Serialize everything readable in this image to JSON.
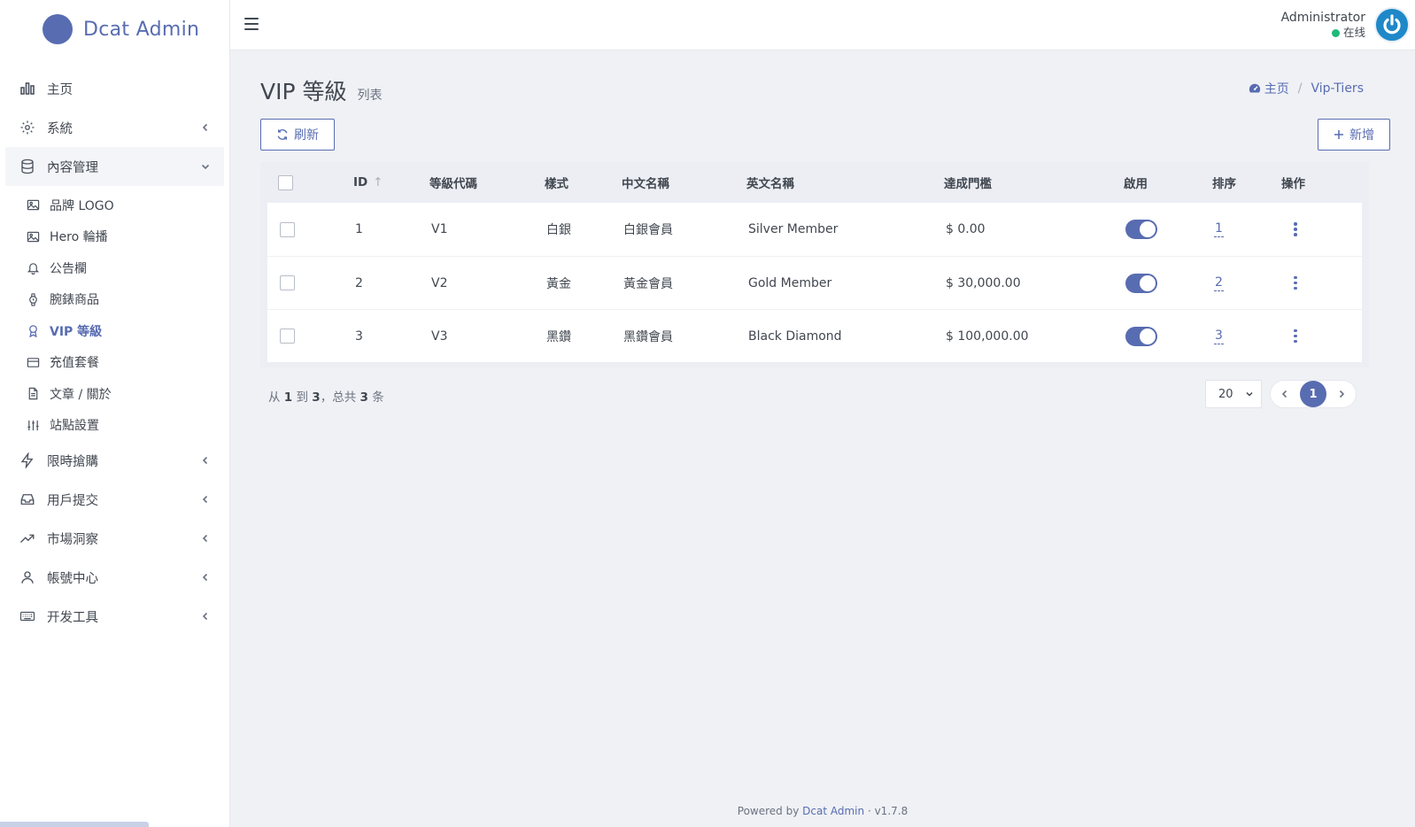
{
  "brand": {
    "name": "Dcat Admin"
  },
  "sidebar": {
    "items": [
      {
        "label": "主页",
        "icon": "bar-chart-icon"
      },
      {
        "label": "系統",
        "icon": "gear-icon"
      },
      {
        "label": "內容管理",
        "icon": "database-icon"
      },
      {
        "label": "限時搶購",
        "icon": "lightning-icon"
      },
      {
        "label": "用戶提交",
        "icon": "inbox-icon"
      },
      {
        "label": "市場洞察",
        "icon": "trending-up-icon"
      },
      {
        "label": "帳號中心",
        "icon": "user-icon"
      },
      {
        "label": "开发工具",
        "icon": "keyboard-icon"
      }
    ],
    "submenu": [
      {
        "label": "品牌 LOGO",
        "icon": "image-icon"
      },
      {
        "label": "Hero 輪播",
        "icon": "image-icon"
      },
      {
        "label": "公告欄",
        "icon": "bell-icon"
      },
      {
        "label": "腕錶商品",
        "icon": "watch-icon"
      },
      {
        "label": "VIP 等級",
        "icon": "award-icon"
      },
      {
        "label": "充值套餐",
        "icon": "credit-card-icon"
      },
      {
        "label": "文章 / 關於",
        "icon": "document-icon"
      },
      {
        "label": "站點設置",
        "icon": "sliders-icon"
      }
    ]
  },
  "header": {
    "user_name": "Administrator",
    "user_status": "在线"
  },
  "page": {
    "title": "VIP 等級",
    "subtitle": "列表",
    "breadcrumb": {
      "home": "主页",
      "current": "Vip-Tiers"
    },
    "refresh_label": "刷新",
    "new_label": "新增"
  },
  "table": {
    "headers": {
      "id": "ID",
      "code": "等級代碼",
      "style": "樣式",
      "cn_name": "中文名稱",
      "en_name": "英文名稱",
      "threshold": "達成門檻",
      "enabled": "啟用",
      "sort": "排序",
      "actions": "操作"
    },
    "rows": [
      {
        "id": "1",
        "code": "V1",
        "style": "白銀",
        "cn_name": "白銀會員",
        "en_name": "Silver Member",
        "threshold": "$ 0.00",
        "enabled": true,
        "sort": "1"
      },
      {
        "id": "2",
        "code": "V2",
        "style": "黃金",
        "cn_name": "黃金會員",
        "en_name": "Gold Member",
        "threshold": "$ 30,000.00",
        "enabled": true,
        "sort": "2"
      },
      {
        "id": "3",
        "code": "V3",
        "style": "黑鑽",
        "cn_name": "黑鑽會員",
        "en_name": "Black Diamond",
        "threshold": "$ 100,000.00",
        "enabled": true,
        "sort": "3"
      }
    ]
  },
  "pagination": {
    "summary_prefix": "从",
    "from": "1",
    "summary_to": "到",
    "to": "3",
    "summary_total": "，总共",
    "total": "3",
    "summary_suffix": "条",
    "per_page": "20",
    "current_page": "1"
  },
  "footer": {
    "powered_by": "Powered by",
    "link": "Dcat Admin",
    "version": "· v1.7.8"
  },
  "colors": {
    "primary": "#586cb1",
    "success": "#21b978",
    "background": "#eff1f5"
  }
}
